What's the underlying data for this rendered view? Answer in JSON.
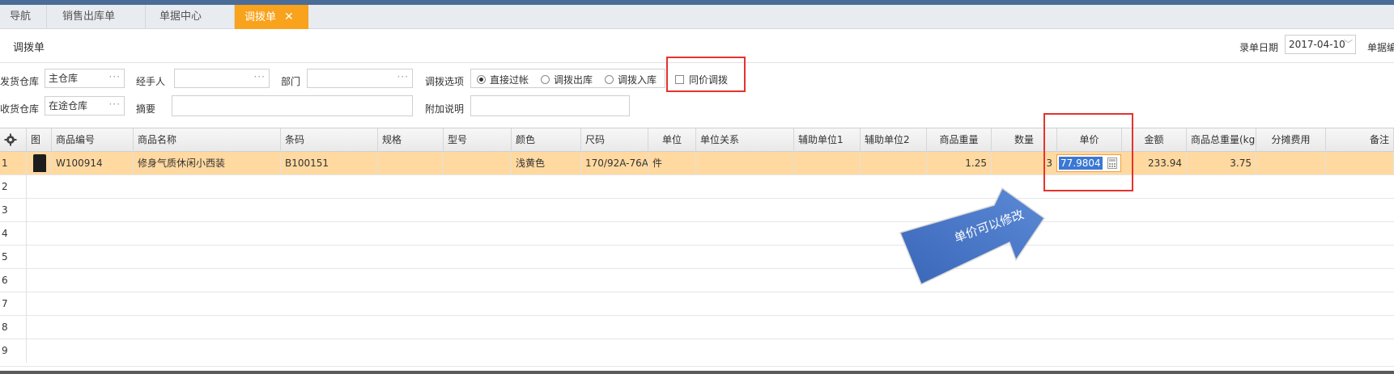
{
  "tabs": [
    {
      "label": "导航"
    },
    {
      "label": "销售出库单"
    },
    {
      "label": "单据中心"
    },
    {
      "label": "调拨单",
      "close": "✕"
    }
  ],
  "page_title": "调拨单",
  "header": {
    "date_label": "录单日期",
    "date_value": "2017-04-10",
    "billno_label": "单据编"
  },
  "form": {
    "from_warehouse_label": "发货仓库",
    "from_warehouse_value": "主仓库",
    "to_warehouse_label": "收货仓库",
    "to_warehouse_value": "在途仓库",
    "handler_label": "经手人",
    "handler_value": "",
    "dept_label": "部门",
    "dept_value": "",
    "summary_label": "摘要",
    "summary_value": "",
    "transfer_option_label": "调拨选项",
    "radio_options": [
      "直接过帐",
      "调拨出库",
      "调拨入库"
    ],
    "radio_selected": "直接过帐",
    "extra_label": "附加说明",
    "extra_value": "",
    "same_price_label": "同价调拨",
    "same_price_checked": false,
    "dots": "···"
  },
  "grid": {
    "columns": [
      "图",
      "商品编号",
      "商品名称",
      "条码",
      "规格",
      "型号",
      "颜色",
      "尺码",
      "单位",
      "单位关系",
      "辅助单位1",
      "辅助单位2",
      "商品重量",
      "数量",
      "单价",
      "金额",
      "商品总重量(kg)",
      "分摊费用",
      "备注"
    ],
    "rows": [
      {
        "num": "1",
        "code": "W100914",
        "name": "修身气质休闲小西装",
        "barcode": "B100151",
        "spec": "",
        "model": "",
        "color": "浅黄色",
        "size": "170/92A-76A",
        "unit": "件",
        "unit_rel": "",
        "aux1": "",
        "aux2": "",
        "weight": "1.25",
        "qty": "3",
        "price": "77.9804",
        "amount": "233.94",
        "total_weight": "3.75",
        "fee": "",
        "remark": ""
      },
      {
        "num": "2"
      },
      {
        "num": "3"
      },
      {
        "num": "4"
      },
      {
        "num": "5"
      },
      {
        "num": "6"
      },
      {
        "num": "7"
      },
      {
        "num": "8"
      },
      {
        "num": "9"
      }
    ]
  },
  "annotation": {
    "arrow_text": "单价可以修改",
    "arrow_color": "#4a79c8",
    "highlight_color": "#e5322d"
  }
}
